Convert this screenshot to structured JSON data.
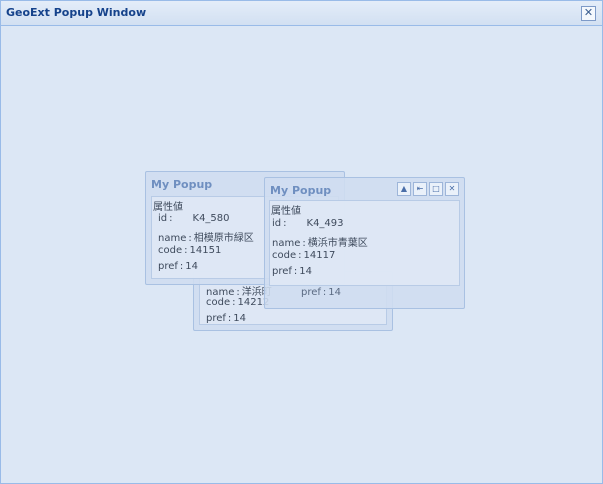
{
  "window": {
    "title": "GeoExt Popup Window",
    "close_glyph": "✕"
  },
  "popups": {
    "back": {
      "rows": [
        {
          "key": "name",
          "value": "洋浜町"
        },
        {
          "key": "code",
          "value": "14212"
        },
        {
          "key": "pref",
          "value": "14"
        }
      ]
    },
    "left": {
      "title": "My Popup",
      "heading": "属性値",
      "rows": [
        {
          "key": "id",
          "value": "K4_580"
        },
        {
          "key": "name",
          "value": "相模原市緑区"
        },
        {
          "key": "code",
          "value": "14151"
        },
        {
          "key": "pref",
          "value": "14"
        }
      ]
    },
    "front": {
      "title": "My Popup",
      "heading": "属性値",
      "rows": [
        {
          "key": "id",
          "value": "K4_493"
        },
        {
          "key": "name",
          "value": "横浜市青葉区"
        },
        {
          "key": "code",
          "value": "14117"
        },
        {
          "key": "pref",
          "value": "14"
        }
      ],
      "footer_row": {
        "key": "pref",
        "value": "14"
      },
      "tools": [
        "collapse-icon",
        "unpin-icon",
        "maximize-icon",
        "close-icon"
      ],
      "tool_glyphs": {
        "collapse": "▲",
        "unpin": "⇤",
        "maximize": "□",
        "close": "✕"
      }
    }
  }
}
